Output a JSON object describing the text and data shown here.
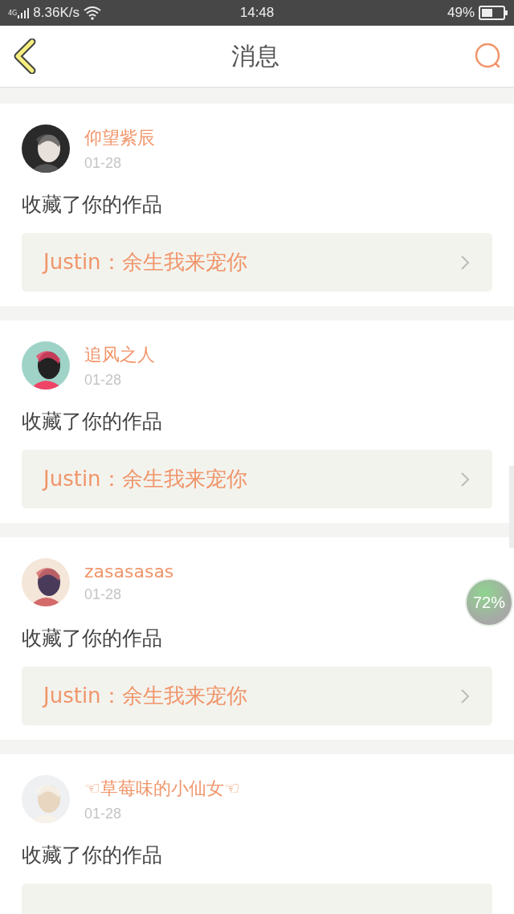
{
  "status_bar": {
    "network": "4G",
    "speed": "8.36K/s",
    "time": "14:48",
    "battery": "49%"
  },
  "header": {
    "title": "消息"
  },
  "messages": [
    {
      "name": "仰望紫辰",
      "date": "01-28",
      "action": "收藏了你的作品",
      "link": "Justin：余生我来宠你"
    },
    {
      "name": "追风之人",
      "date": "01-28",
      "action": "收藏了你的作品",
      "link": "Justin：余生我来宠你"
    },
    {
      "name": "zasasasas",
      "date": "01-28",
      "action": "收藏了你的作品",
      "link": "Justin：余生我来宠你"
    },
    {
      "name": "☜草莓味的小仙女☜",
      "date": "01-28",
      "action": "收藏了你的作品"
    }
  ],
  "floating_widget": {
    "text": "72%"
  }
}
